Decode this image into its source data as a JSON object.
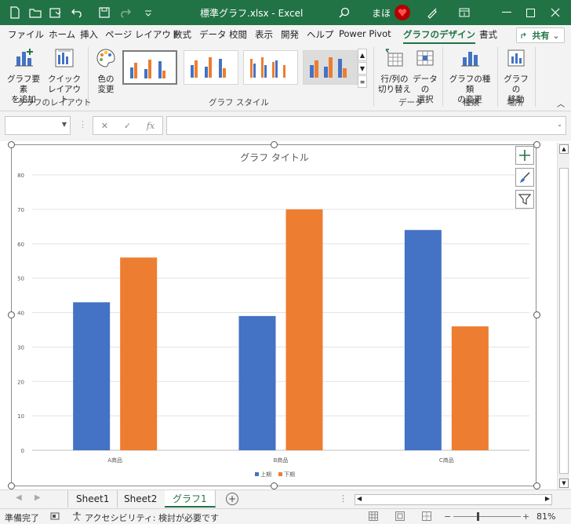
{
  "titlebar": {
    "title": "標準グラフ.xlsx  -  Excel",
    "user": "まほ",
    "colors": {
      "bg": "#217346"
    }
  },
  "menu": {
    "tabs": [
      "ファイル",
      "ホーム",
      "挿入",
      "ページ レイアウト",
      "数式",
      "データ",
      "校閲",
      "表示",
      "開発",
      "ヘルプ",
      "Power Pivot",
      "グラフのデザイン",
      "書式"
    ],
    "active": "グラフのデザイン",
    "share": "共有"
  },
  "ribbon": {
    "add_element": "グラフ要素\nを追加",
    "quick_layout": "クイック\nレイアウト",
    "change_color": "色の\n変更",
    "switch_row_col": "行/列の\n切り替え",
    "select_data": "データの\n選択",
    "change_type": "グラフの種類\nの変更",
    "move_chart": "グラフの\n移動",
    "groups": {
      "layout": "グラフのレイアウト",
      "styles": "グラフ スタイル",
      "data": "データ",
      "type": "種類",
      "location": "場所"
    }
  },
  "formula": {
    "fx": "fx",
    "cancel": "✕",
    "enter": "✓"
  },
  "chart_data": {
    "type": "bar",
    "title": "グラフ タイトル",
    "categories": [
      "A商品",
      "B商品",
      "C商品"
    ],
    "series": [
      {
        "name": "上期",
        "values": [
          43,
          39,
          64
        ],
        "color": "#4472C4"
      },
      {
        "name": "下期",
        "values": [
          56,
          70,
          36
        ],
        "color": "#ED7D31"
      }
    ],
    "ylim": [
      0,
      80
    ],
    "yticks": [
      0,
      10,
      20,
      30,
      40,
      50,
      60,
      70,
      80
    ],
    "grid": true,
    "legend": "bottom"
  },
  "sheets": {
    "tabs": [
      "Sheet1",
      "Sheet2",
      "グラフ1"
    ],
    "active": "グラフ1"
  },
  "status": {
    "ready": "準備完了",
    "accessibility": "アクセシビリティ: 検討が必要です",
    "zoom": "81%"
  }
}
